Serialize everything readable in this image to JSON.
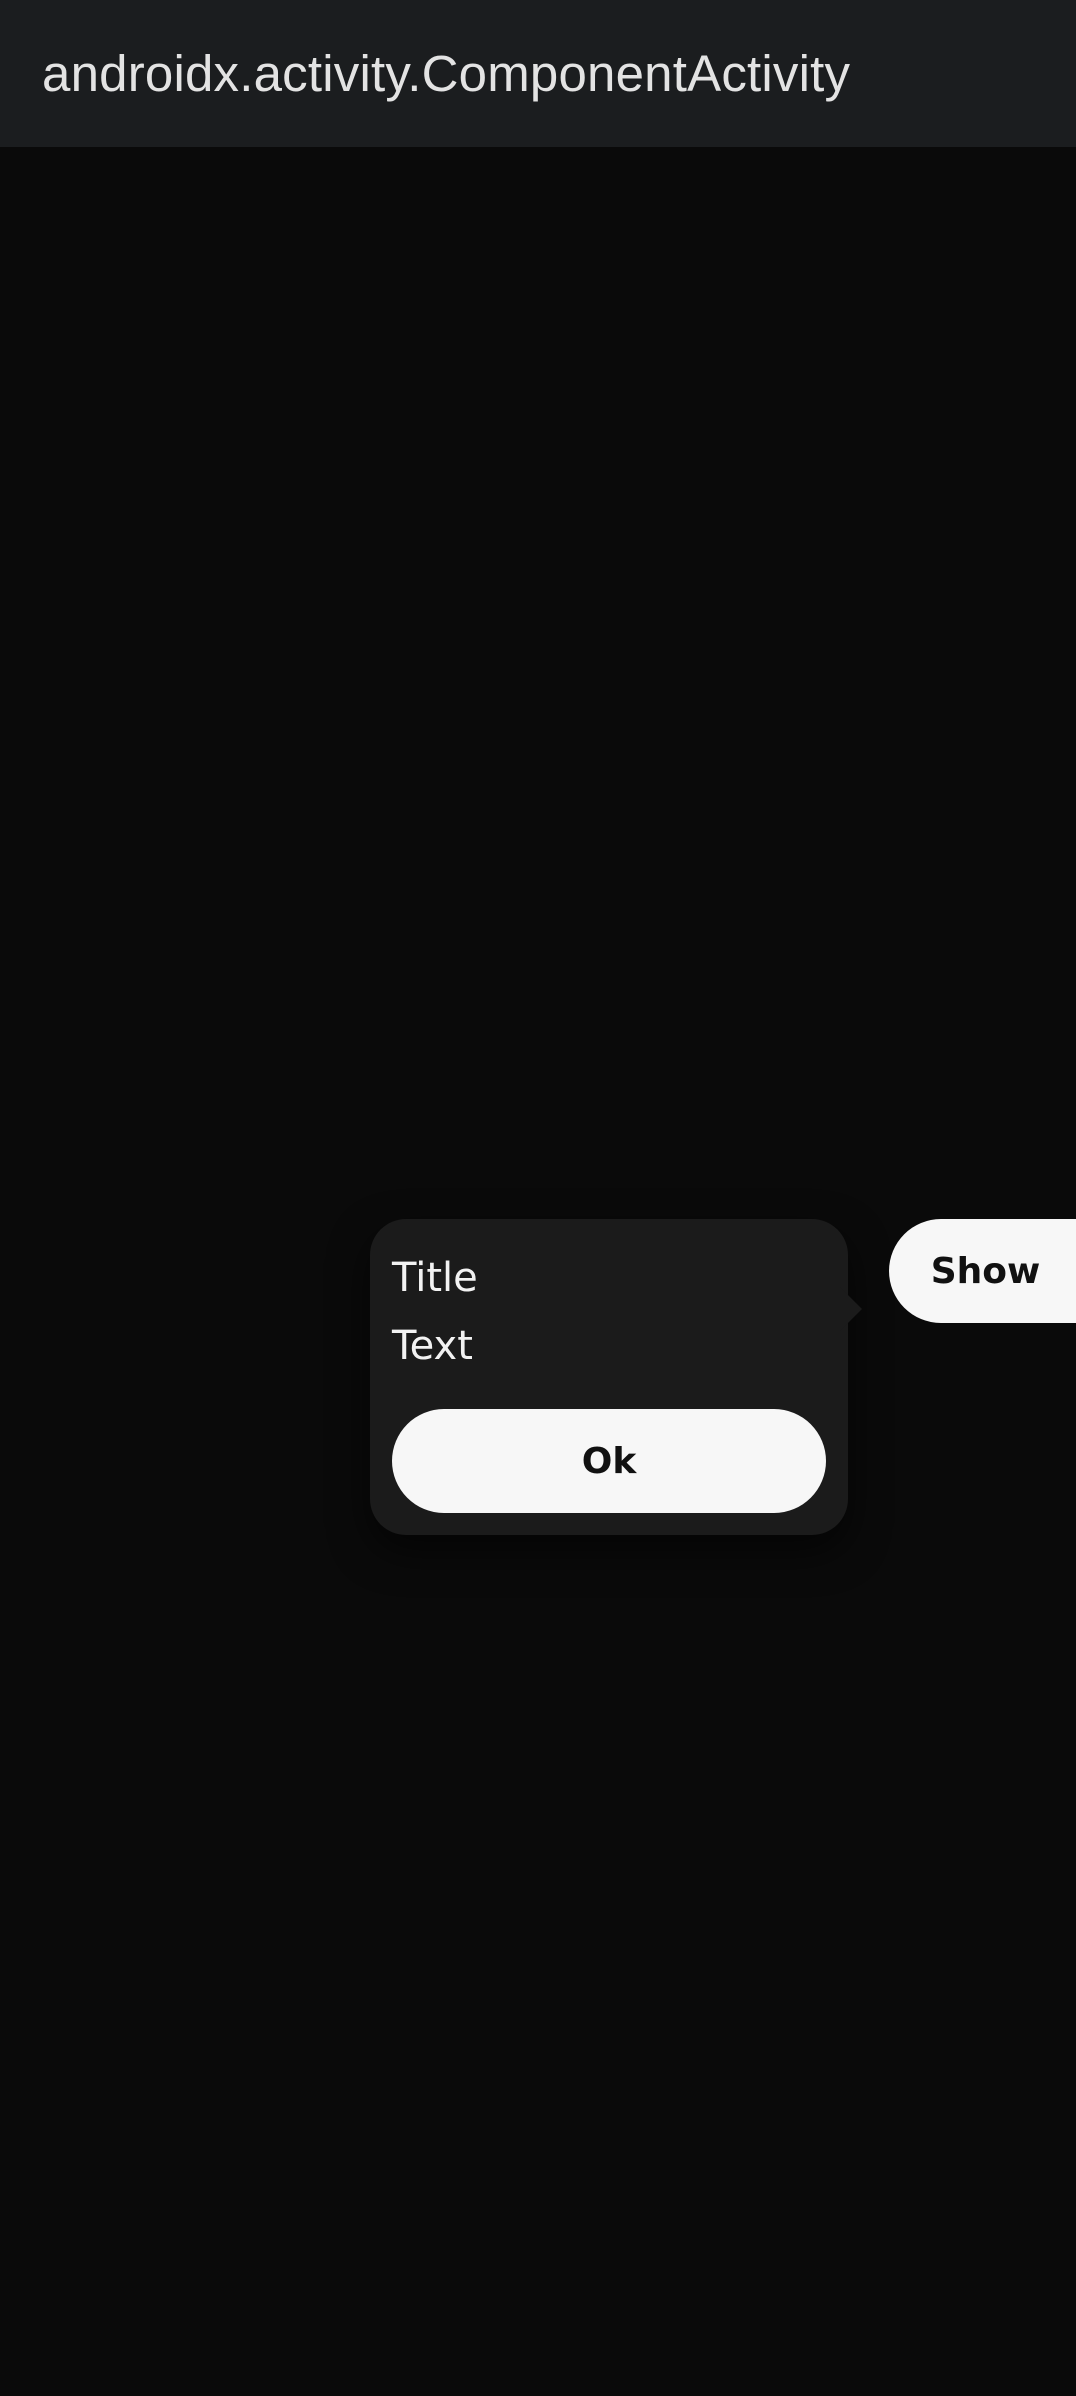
{
  "app_bar": {
    "title": "androidx.activity.ComponentActivity"
  },
  "tooltip": {
    "title": "Title",
    "text": "Text",
    "ok_label": "Ok"
  },
  "show_button": {
    "label": "Show"
  }
}
